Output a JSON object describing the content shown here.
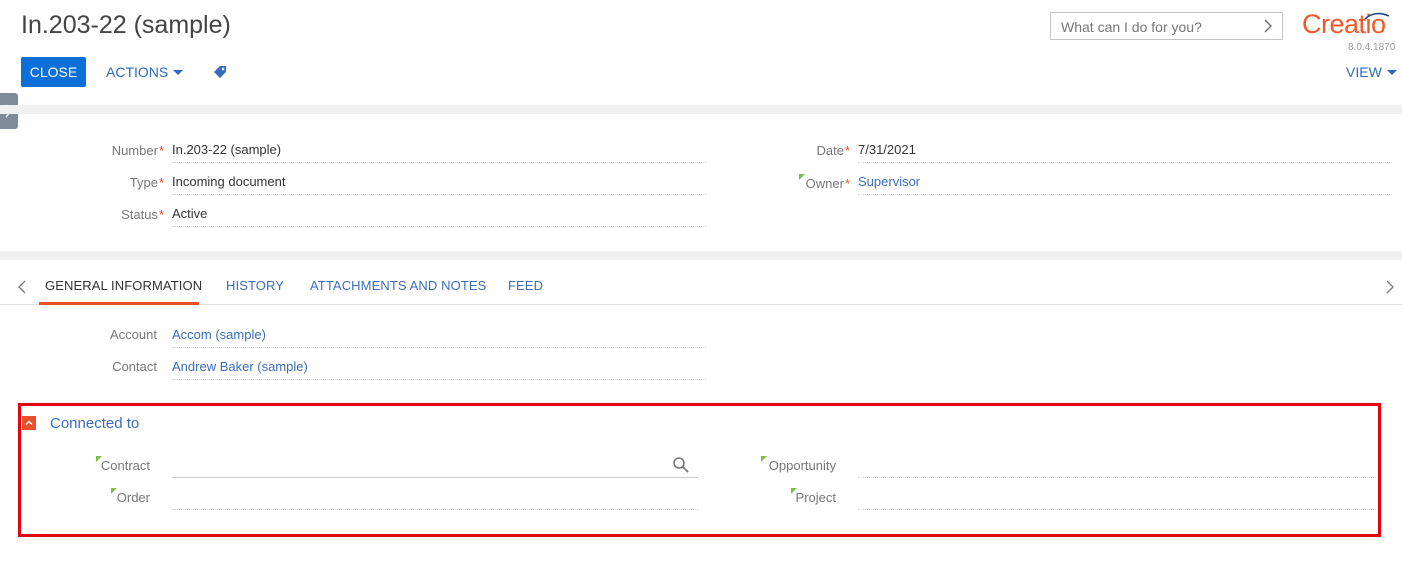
{
  "header": {
    "title": "In.203-22 (sample)",
    "search_placeholder": "What can I do for you?",
    "logo": "Creatio",
    "version": "8.0.4.1870"
  },
  "toolbar": {
    "close_label": "CLOSE",
    "actions_label": "ACTIONS",
    "view_label": "VIEW"
  },
  "primary_fields": {
    "number": {
      "label": "Number",
      "value": "In.203-22 (sample)"
    },
    "type": {
      "label": "Type",
      "value": "Incoming document"
    },
    "status": {
      "label": "Status",
      "value": "Active"
    },
    "date": {
      "label": "Date",
      "value": "7/31/2021"
    },
    "owner": {
      "label": "Owner",
      "value": "Supervisor"
    }
  },
  "tabs": [
    {
      "label": "GENERAL INFORMATION",
      "active": true
    },
    {
      "label": "HISTORY",
      "active": false
    },
    {
      "label": "ATTACHMENTS AND NOTES",
      "active": false
    },
    {
      "label": "FEED",
      "active": false
    }
  ],
  "general": {
    "account": {
      "label": "Account",
      "value": "Accom (sample)"
    },
    "contact": {
      "label": "Contact",
      "value": "Andrew Baker (sample)"
    }
  },
  "connected": {
    "title": "Connected to",
    "contract_label": "Contract",
    "order_label": "Order",
    "opportunity_label": "Opportunity",
    "project_label": "Project"
  },
  "colors": {
    "primary_button": "#0d6fd8",
    "link": "#3a6ebd",
    "accent": "#e94f2a",
    "highlight_border": "#e30612",
    "logo": "#f05a28"
  }
}
